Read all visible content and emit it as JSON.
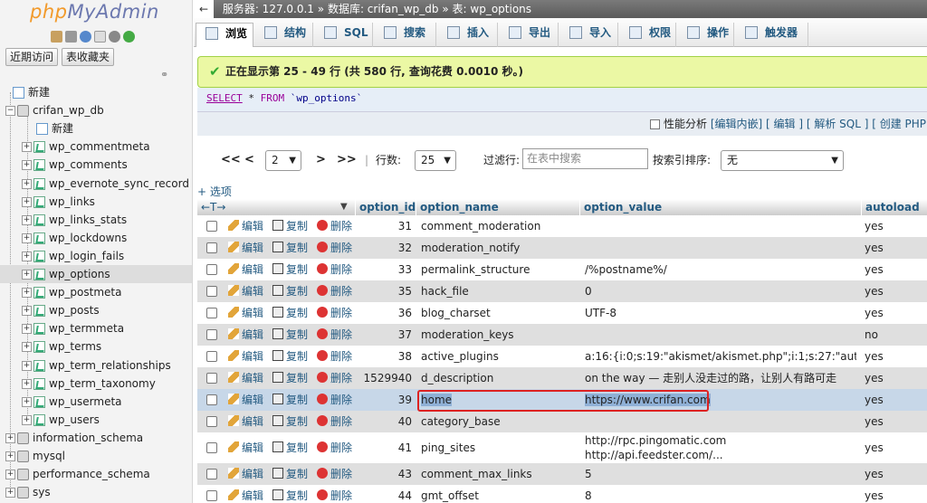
{
  "logo": {
    "php": "php",
    "myadmin": "MyAdmin"
  },
  "left_buttons": [
    "近期访问",
    "表收藏夹"
  ],
  "tree": {
    "new_server": "新建",
    "db_name": "crifan_wp_db",
    "db_new": "新建",
    "tables": [
      "wp_commentmeta",
      "wp_comments",
      "wp_evernote_sync_record",
      "wp_links",
      "wp_links_stats",
      "wp_lockdowns",
      "wp_login_fails",
      "wp_options",
      "wp_postmeta",
      "wp_posts",
      "wp_termmeta",
      "wp_terms",
      "wp_term_relationships",
      "wp_term_taxonomy",
      "wp_usermeta",
      "wp_users"
    ],
    "other_dbs": [
      "information_schema",
      "mysql",
      "performance_schema",
      "sys"
    ]
  },
  "breadcrumb": {
    "server": "服务器: 127.0.0.1",
    "sep": "»",
    "database": "数据库: crifan_wp_db",
    "table": "表: wp_options"
  },
  "tabs": [
    "浏览",
    "结构",
    "SQL",
    "搜索",
    "插入",
    "导出",
    "导入",
    "权限",
    "操作",
    "触发器"
  ],
  "success_message": "正在显示第 25 - 49 行 (共 580 行, 查询花费 0.0010 秒。)",
  "sql": {
    "select": "SELECT",
    "star": " * ",
    "from": "FROM",
    "table": " `wp_options`"
  },
  "profiling": {
    "label": "性能分析",
    "links": "[编辑内嵌] [ 编辑 ] [ 解析 SQL ] [ 创建 PHP 代"
  },
  "pager": {
    "first": "<<",
    "prev": "<",
    "page": "2",
    "next": ">",
    "last": ">>",
    "rows_label": "行数:",
    "rows": "25",
    "filter_label": "过滤行:",
    "filter_placeholder": "在表中搜索",
    "sort_label": "按索引排序:",
    "sort_value": "无"
  },
  "options_link": "+ 选项",
  "columns": {
    "sort_arrows": "←T→",
    "option_id": "option_id",
    "option_name": "option_name",
    "option_value": "option_value",
    "autoload": "autoload"
  },
  "actions": {
    "edit": "编辑",
    "copy": "复制",
    "delete": "删除"
  },
  "rows": [
    {
      "id": "31",
      "name": "comment_moderation",
      "value": "",
      "value2": "",
      "autoload": "yes"
    },
    {
      "id": "32",
      "name": "moderation_notify",
      "value": "",
      "value2": "",
      "autoload": "yes"
    },
    {
      "id": "33",
      "name": "permalink_structure",
      "value": "/%postname%/",
      "value2": "",
      "autoload": "yes"
    },
    {
      "id": "35",
      "name": "hack_file",
      "value": "0",
      "value2": "",
      "autoload": "yes"
    },
    {
      "id": "36",
      "name": "blog_charset",
      "value": "UTF-8",
      "value2": "",
      "autoload": "yes"
    },
    {
      "id": "37",
      "name": "moderation_keys",
      "value": "",
      "value2": "",
      "autoload": "no"
    },
    {
      "id": "38",
      "name": "active_plugins",
      "value": "a:16:{i:0;s:19:\"akismet/akismet.php\";i:1;s:27:\"aut...",
      "value2": "",
      "autoload": "yes"
    },
    {
      "id": "1529940",
      "name": "d_description",
      "value": "on the way — 走别人没走过的路，让别人有路可走",
      "value2": "",
      "autoload": "yes"
    },
    {
      "id": "39",
      "name": "home",
      "value": "https://www.crifan.com",
      "value2": "",
      "autoload": "yes"
    },
    {
      "id": "40",
      "name": "category_base",
      "value": "",
      "value2": "",
      "autoload": "yes"
    },
    {
      "id": "41",
      "name": "ping_sites",
      "value": "http://rpc.pingomatic.com",
      "value2": "http://api.feedster.com/...",
      "autoload": "yes"
    },
    {
      "id": "43",
      "name": "comment_max_links",
      "value": "5",
      "value2": "",
      "autoload": "yes"
    },
    {
      "id": "44",
      "name": "gmt_offset",
      "value": "8",
      "value2": "",
      "autoload": "yes"
    }
  ]
}
